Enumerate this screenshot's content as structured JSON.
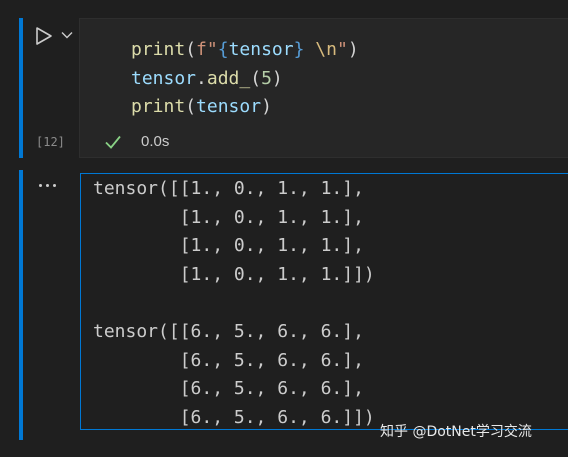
{
  "cell": {
    "exec_count": "[12]",
    "status_time": "0.0s",
    "code_lines": [
      [
        {
          "t": "print",
          "c": "c-fn"
        },
        {
          "t": "(",
          "c": "c-pun"
        },
        {
          "t": "f\"",
          "c": "c-str"
        },
        {
          "t": "{",
          "c": "c-brace"
        },
        {
          "t": "tensor",
          "c": "c-var"
        },
        {
          "t": "}",
          "c": "c-brace"
        },
        {
          "t": " ",
          "c": "c-str"
        },
        {
          "t": "\\n",
          "c": "c-esc"
        },
        {
          "t": "\"",
          "c": "c-str"
        },
        {
          "t": ")",
          "c": "c-pun"
        }
      ],
      [
        {
          "t": "tensor",
          "c": "c-var"
        },
        {
          "t": ".",
          "c": "c-pun"
        },
        {
          "t": "add_",
          "c": "c-fn"
        },
        {
          "t": "(",
          "c": "c-pun"
        },
        {
          "t": "5",
          "c": "c-num"
        },
        {
          "t": ")",
          "c": "c-pun"
        }
      ],
      [
        {
          "t": "print",
          "c": "c-fn"
        },
        {
          "t": "(",
          "c": "c-pun"
        },
        {
          "t": "tensor",
          "c": "c-var"
        },
        {
          "t": ")",
          "c": "c-pun"
        }
      ]
    ]
  },
  "output": {
    "text": "tensor([[1., 0., 1., 1.],\n        [1., 0., 1., 1.],\n        [1., 0., 1., 1.],\n        [1., 0., 1., 1.]])\n\ntensor([[6., 5., 6., 6.],\n        [6., 5., 6., 6.],\n        [6., 5., 6., 6.],\n        [6., 5., 6., 6.]])"
  },
  "icons": {
    "run": "play-icon",
    "run_menu": "chevron-down-icon",
    "status": "check-icon",
    "output_menu": "ellipsis-icon"
  },
  "colors": {
    "accent": "#0078d4",
    "success": "#89d185"
  },
  "watermark": "知乎 @DotNet学习交流"
}
